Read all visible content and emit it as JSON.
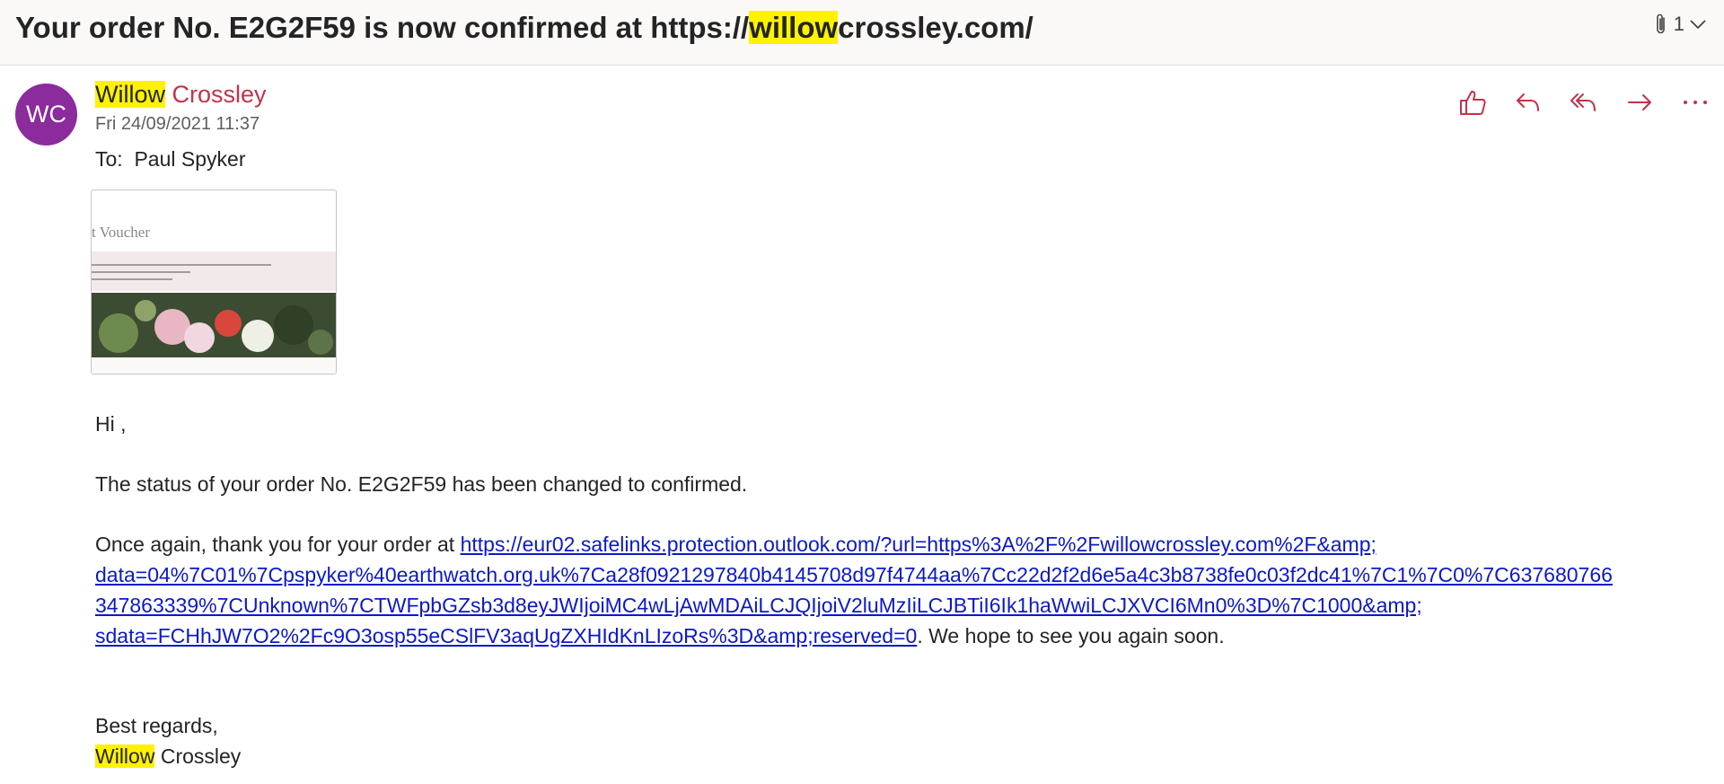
{
  "subject": {
    "prefix": "Your order No. E2G2F59 is now confirmed at https://",
    "highlight": "willow",
    "suffix": "crossley.com/"
  },
  "attachments": {
    "icon": "paperclip-icon",
    "count": "1",
    "expand_icon": "chevron-down-icon"
  },
  "sender": {
    "initials": "WC",
    "first_name": "Willow",
    "last_name": "Crossley",
    "date": "Fri 24/09/2021 11:37",
    "to_label": "To:",
    "to_name": "Paul Spyker"
  },
  "actions": [
    {
      "name": "like-icon"
    },
    {
      "name": "reply-icon"
    },
    {
      "name": "reply-all-icon"
    },
    {
      "name": "forward-icon"
    },
    {
      "name": "more-icon"
    }
  ],
  "thumbnail": {
    "title": "t Voucher"
  },
  "body": {
    "greeting": "Hi ,",
    "status_line": "The status of your order No. E2G2F59 has been changed to confirmed.",
    "thanks_prefix": "Once again, thank you for your order at ",
    "link_lines": [
      "https://eur02.safelinks.protection.outlook.com/?url=https%3A%2F%2Fwillowcrossley.com%2F&amp;",
      "data=04%7C01%7Cpspyker%40earthwatch.org.uk%7Ca28f0921297840b4145708d97f4744aa%7Cc22d2f2d6e5a4c3b8738fe0c03f2dc41%7C1%7C0%7C637680766",
      "347863339%7CUnknown%7CTWFpbGZsb3d8eyJWIjoiMC4wLjAwMDAiLCJQIjoiV2luMzIiLCJBTiI6Ik1haWwiLCJXVCI6Mn0%3D%7C1000&amp;",
      "sdata=FCHhJW7O2%2Fc9O3osp55eCSlFV3aqUgZXHIdKnLIzoRs%3D&amp;reserved=0"
    ],
    "thanks_suffix": ". We hope to see you again soon.",
    "closing": "Best regards,",
    "signature_highlight": "Willow",
    "signature_rest": " Crossley"
  },
  "colors": {
    "accent": "#c4314b",
    "highlight": "#fff200",
    "avatar": "#8b2b9c",
    "link": "#0b19c8"
  }
}
